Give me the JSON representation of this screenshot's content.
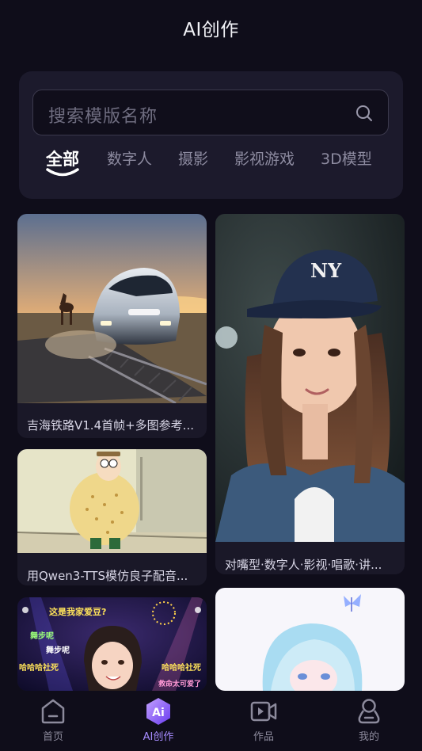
{
  "header": {
    "title": "AI创作"
  },
  "search": {
    "placeholder": "搜索模版名称"
  },
  "tabs": [
    {
      "label": "全部",
      "active": true
    },
    {
      "label": "数字人"
    },
    {
      "label": "摄影"
    },
    {
      "label": "影视游戏"
    },
    {
      "label": "3D模型"
    }
  ],
  "cards": [
    {
      "title": "吉海铁路V1.4首帧+多图参考..."
    },
    {
      "title": "对嘴型·数字人·影视·唱歌·讲..."
    },
    {
      "title": "用Qwen3-TTS模仿良子配音..."
    },
    {
      "title": "",
      "overlay": [
        "这是我家爱豆?",
        "舞步呢",
        "舞步呢",
        "哈哈哈社死",
        "哈哈哈社死",
        "救命太可爱了"
      ]
    },
    {
      "title": ""
    }
  ],
  "nav": [
    {
      "label": "首页",
      "icon": "home-icon"
    },
    {
      "label": "AI创作",
      "icon": "ai-icon",
      "active": true,
      "badge": "Ai"
    },
    {
      "label": "作品",
      "icon": "video-icon"
    },
    {
      "label": "我的",
      "icon": "profile-icon"
    }
  ],
  "colors": {
    "background": "#0f0d1a",
    "panel": "#1c1a2c",
    "accent": "#a68bff"
  }
}
